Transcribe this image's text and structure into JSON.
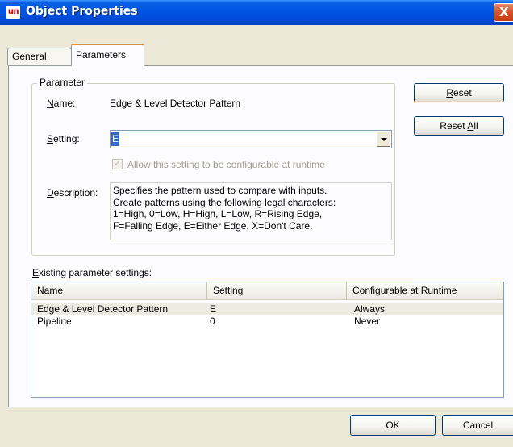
{
  "window": {
    "app_icon_text": "un",
    "title": "Object Properties",
    "close_symbol": "X"
  },
  "tabs": [
    {
      "label": "General",
      "active": false
    },
    {
      "label": "Parameters",
      "active": true
    }
  ],
  "parameter_group": {
    "legend": "Parameter",
    "name_label_accel": "N",
    "name_label_rest": "ame:",
    "name_value": "Edge & Level Detector Pattern",
    "setting_label_accel": "S",
    "setting_label_rest": "etting:",
    "setting_value": "E",
    "runtime_checkbox_accel": "A",
    "runtime_checkbox_rest": "llow this setting to be configurable at runtime",
    "runtime_checked": true,
    "description_label_accel": "D",
    "description_label_rest": "escription:",
    "description_lines": [
      "Specifies the pattern used to compare with inputs.",
      "Create patterns using the following legal characters:",
      "1=High, 0=Low, H=High, L=Low, R=Rising Edge,",
      "F=Falling Edge, E=Either Edge, X=Don't Care."
    ]
  },
  "buttons": {
    "reset_accel": "R",
    "reset_rest": "eset",
    "reset_all_pre": "Reset ",
    "reset_all_accel": "A",
    "reset_all_post": "ll",
    "ok": "OK",
    "cancel": "Cancel"
  },
  "existing": {
    "label_accel": "E",
    "label_rest": "xisting parameter settings:",
    "columns": [
      "Name",
      "Setting",
      "Configurable at Runtime"
    ],
    "rows": [
      {
        "name": "Edge & Level Detector Pattern",
        "setting": "E",
        "configurable": "Always"
      },
      {
        "name": "Pipeline",
        "setting": "0",
        "configurable": "Never"
      }
    ]
  },
  "icons": {
    "app": "uniface-app-icon",
    "close": "close-icon",
    "dropdown": "chevron-down-icon",
    "check": "check-icon"
  },
  "colors": {
    "titlebar": "#0054e3",
    "selection": "#316ac5",
    "tab_highlight": "#e68b2c",
    "face": "#ece9d8"
  }
}
